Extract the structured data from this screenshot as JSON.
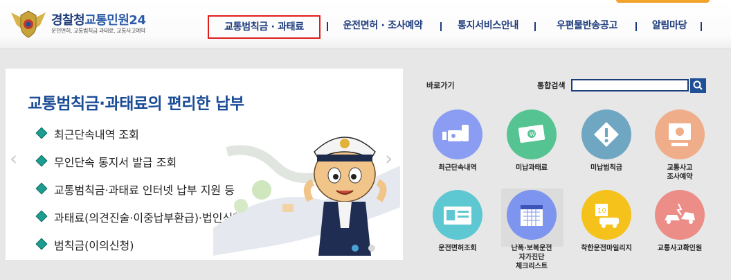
{
  "header": {
    "logo_title_1": "경찰청",
    "logo_title_2": "교통민원24",
    "logo_subtitle": "운전면허, 교통범칙금 과태료, 교통사고예약"
  },
  "nav": {
    "items": [
      {
        "label": "교통범칙금 · 과태료",
        "active": true
      },
      {
        "label": "운전면허 · 조사예약",
        "active": false
      },
      {
        "label": "통지서비스안내",
        "active": false
      },
      {
        "label": "우편물반송공고",
        "active": false
      },
      {
        "label": "알림마당",
        "active": false
      }
    ],
    "active_border_color": "#e01e1e"
  },
  "banner": {
    "title": "교통범칙금·과태료의 편리한 납부",
    "items": [
      "최근단속내역 조회",
      "무인단속 통지서 발급 조회",
      "교통범칙금·과태료 인터넷 납부 지원 등",
      "과태료(의견진술·이중납부환급)·법인신청",
      "범칙금(이의신청)"
    ],
    "prev_icon": "chevron-left-icon",
    "next_icon": "chevron-right-icon"
  },
  "quick": {
    "shortcut_label": "바로가기",
    "search_label": "통합검색",
    "search_value": "",
    "search_icon": "search-icon",
    "items": [
      {
        "label": "최근단속내역",
        "icon": "camera-icon",
        "color": "#8a9df2"
      },
      {
        "label": "미납과태료",
        "icon": "money-icon",
        "color": "#56c393"
      },
      {
        "label": "미납범칙금",
        "icon": "warning-icon",
        "color": "#6fa7c3"
      },
      {
        "label": "교통사고\n조사예약",
        "icon": "monitor-icon",
        "color": "#f0ad89"
      },
      {
        "label": "운전면허조회",
        "icon": "license-card-icon",
        "color": "#5ec8d2"
      },
      {
        "label": "난폭·보복운전\n자가진단\n체크리스트",
        "icon": "calendar-icon",
        "color": "#7d95ee"
      },
      {
        "label": "착한운전마일리지",
        "icon": "mileage-car-icon",
        "color": "#f5c21b"
      },
      {
        "label": "교통사고확인원",
        "icon": "car-crash-icon",
        "color": "#ec8d87"
      }
    ]
  },
  "colors": {
    "brand_navy": "#1c3a7c",
    "title_blue": "#1b4c96",
    "bullet_teal": "#1d9d8f",
    "orange_accent": "#f2a32c"
  }
}
